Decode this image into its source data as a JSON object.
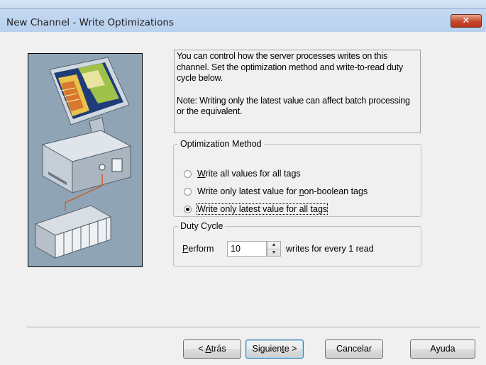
{
  "window": {
    "title": "New Channel - Write Optimizations",
    "close_glyph": "✕"
  },
  "info": {
    "line1": "You can control how the server processes writes on this channel.  Set the optimization method and write-to-read duty cycle below.",
    "line2": "Note:  Writing only the latest value can affect batch processing or the equivalent."
  },
  "optimization": {
    "legend": "Optimization Method",
    "options": [
      {
        "label": "Write all values for all tags",
        "accel_index": 0,
        "selected": false
      },
      {
        "label": "Write only latest value for non-boolean tags",
        "accel_index": 27,
        "selected": false
      },
      {
        "label": "Write only latest value for all tags",
        "accel_index": null,
        "selected": true
      }
    ]
  },
  "duty_cycle": {
    "legend": "Duty Cycle",
    "perform_label": "Perform",
    "value": "10",
    "suffix": "writes for every 1 read"
  },
  "buttons": {
    "back": "< Atrás",
    "next": "Siguiente >",
    "cancel": "Cancelar",
    "help": "Ayuda"
  },
  "icons": {
    "illustration": "computer-plc-network-illustration",
    "spinner_up": "spin-up-icon",
    "spinner_down": "spin-down-icon"
  },
  "colors": {
    "illustration_bg": "#8fa5b6",
    "close_button": "#c7472b",
    "default_button_border": "#3c7fb1"
  }
}
